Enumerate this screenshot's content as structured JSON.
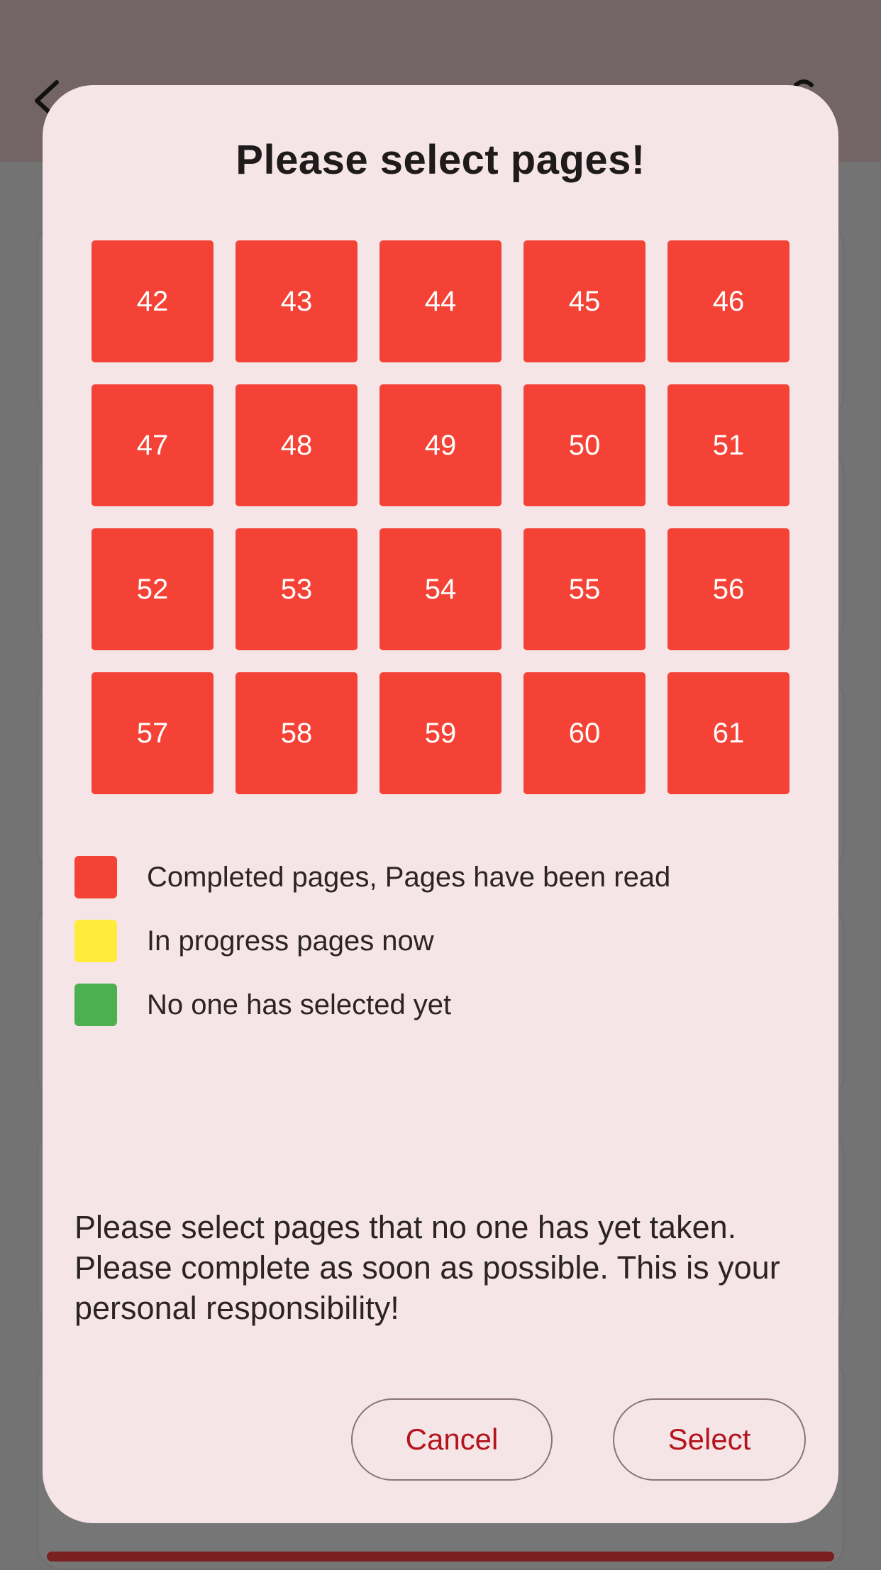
{
  "dialog": {
    "title": "Please select pages!",
    "pages": [
      "42",
      "43",
      "44",
      "45",
      "46",
      "47",
      "48",
      "49",
      "50",
      "51",
      "52",
      "53",
      "54",
      "55",
      "56",
      "57",
      "58",
      "59",
      "60",
      "61"
    ],
    "page_color": "#f44336",
    "legend": [
      {
        "color": "#f44336",
        "label": "Completed pages, Pages have been read"
      },
      {
        "color": "#ffeb3b",
        "label": "In progress pages now"
      },
      {
        "color": "#4caf50",
        "label": "No one has selected yet"
      }
    ],
    "message": "Please select pages that no one has yet taken. Please complete as soon as possible. This is your personal responsibility!",
    "cancel_label": "Cancel",
    "select_label": "Select"
  },
  "colors": {
    "dialog_background": "#f6e5e6",
    "button_text": "#b3141d",
    "scrim": "#737373"
  }
}
